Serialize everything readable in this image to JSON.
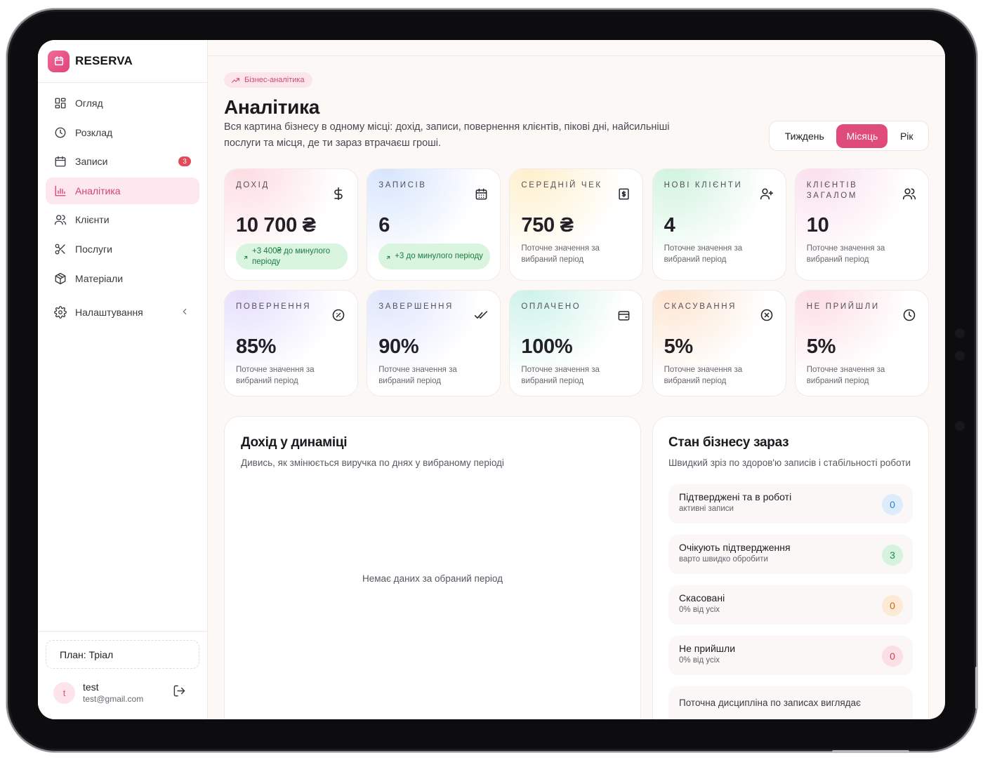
{
  "brand": {
    "name": "RESERVA"
  },
  "sidebar": {
    "items": [
      {
        "label": "Огляд",
        "icon": "grid-icon",
        "active": false
      },
      {
        "label": "Розклад",
        "icon": "clock-icon",
        "active": false
      },
      {
        "label": "Записи",
        "icon": "calendar-icon",
        "active": false,
        "badge": "3"
      },
      {
        "label": "Аналітика",
        "icon": "bar-chart-icon",
        "active": true
      },
      {
        "label": "Клієнти",
        "icon": "users-icon",
        "active": false
      },
      {
        "label": "Послуги",
        "icon": "scissors-icon",
        "active": false
      },
      {
        "label": "Матеріали",
        "icon": "package-icon",
        "active": false
      }
    ],
    "settings": {
      "label": "Налаштування",
      "icon": "gear-icon"
    },
    "plan": "План: Тріал",
    "user": {
      "initial": "t",
      "name": "test",
      "email": "test@gmail.com"
    }
  },
  "header": {
    "pill": "Бізнес-аналітика",
    "title": "Аналітика",
    "description": "Вся картина бізнесу в одному місці: дохід, записи, повернення клієнтів, пікові дні, найсильніші послуги та місця, де ти зараз втрачаєш гроші.",
    "periods": [
      "Тиждень",
      "Місяць",
      "Рік"
    ],
    "active_period": "Місяць"
  },
  "stats": [
    {
      "label": "Дохід",
      "value": "10 700 ₴",
      "delta": "+3 400₴ до минулого періоду",
      "icon": "dollar-icon"
    },
    {
      "label": "Записів",
      "value": "6",
      "delta": "+3 до минулого періоду",
      "icon": "calendar-icon"
    },
    {
      "label": "Середній чек",
      "value": "750 ₴",
      "sub": "Поточне значення за вибраний період",
      "icon": "receipt-icon"
    },
    {
      "label": "Нові клієнти",
      "value": "4",
      "sub": "Поточне значення за вибраний період",
      "icon": "user-plus-icon"
    },
    {
      "label": "Клієнтів загалом",
      "value": "10",
      "sub": "Поточне значення за вибраний період",
      "icon": "users-icon"
    },
    {
      "label": "Повернення",
      "value": "85%",
      "sub": "Поточне значення за вибраний період",
      "icon": "badge-percent-icon"
    },
    {
      "label": "Завершення",
      "value": "90%",
      "sub": "Поточне значення за вибраний період",
      "icon": "double-check-icon"
    },
    {
      "label": "Оплачено",
      "value": "100%",
      "sub": "Поточне значення за вибраний період",
      "icon": "wallet-icon"
    },
    {
      "label": "Скасування",
      "value": "5%",
      "sub": "Поточне значення за вибраний період",
      "icon": "x-circle-icon"
    },
    {
      "label": "Не прийшли",
      "value": "5%",
      "sub": "Поточне значення за вибраний період",
      "icon": "clock-icon"
    }
  ],
  "revenue_panel": {
    "title": "Дохід у динаміці",
    "description": "Дивись, як змінюється виручка по днях у вибраному періоді",
    "empty": "Немає даних за обраний період"
  },
  "status_panel": {
    "title": "Стан бізнесу зараз",
    "description": "Швидкий зріз по здоров'ю записів і стабільності роботи",
    "items": [
      {
        "title": "Підтверджені та в роботі",
        "sub": "активні записи",
        "count": "0",
        "color": "#2f7fd1",
        "bg": "#dcecfb"
      },
      {
        "title": "Очікують підтвердження",
        "sub": "варто швидко обробити",
        "count": "3",
        "color": "#1e8a50",
        "bg": "#d6f3de"
      },
      {
        "title": "Скасовані",
        "sub": "0% від усіх",
        "count": "0",
        "color": "#c2691c",
        "bg": "#fdead4"
      },
      {
        "title": "Не прийшли",
        "sub": "0% від усіх",
        "count": "0",
        "color": "#d23e55",
        "bg": "#fbdfe4"
      }
    ],
    "note": "Поточна дисципліна по записах виглядає"
  },
  "colors": {
    "accent": "#df4c7c",
    "accent_soft": "#fce8ee",
    "success": "#1b7a44"
  }
}
